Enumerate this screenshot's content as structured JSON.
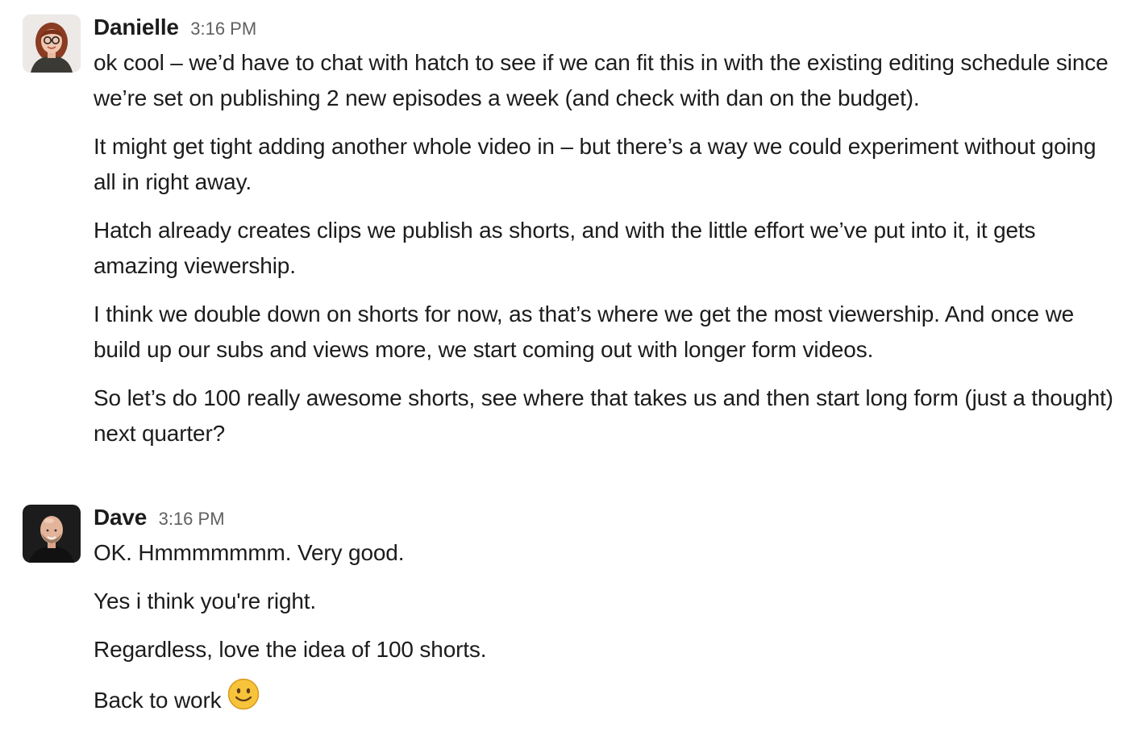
{
  "messages": [
    {
      "author": "Danielle",
      "time": "3:16 PM",
      "avatar_icon": "user-photo-danielle",
      "paragraphs": [
        "ok cool – we’d have to chat with hatch to see if we can fit this in with the existing editing schedule since we’re set on publishing 2 new episodes a week (and check with dan on the budget).",
        "It might get tight adding another whole video in – but there’s a way we could experiment without going all in right away.",
        "Hatch already creates clips we publish as shorts, and with the little effort we’ve put into it, it gets amazing viewership.",
        "I think we double down on shorts for now, as that’s where we get the most viewership. And once we build up our subs and views more, we start coming out with longer form videos.",
        "So let’s do 100 really awesome shorts, see where that takes us and then start long form (just a thought) next quarter?"
      ]
    },
    {
      "author": "Dave",
      "time": "3:16 PM",
      "avatar_icon": "user-photo-dave",
      "paragraphs": [
        "OK. Hmmmmmmm. Very good.",
        "Yes i think you're right.",
        "Regardless, love the idea of 100 shorts.",
        "Back to work"
      ],
      "trailing_emoji": "slightly-smiling-face-icon"
    }
  ],
  "colors": {
    "text": "#1d1c1d",
    "timestamp": "#616061",
    "background": "#ffffff",
    "emoji": "#f7c33a"
  }
}
